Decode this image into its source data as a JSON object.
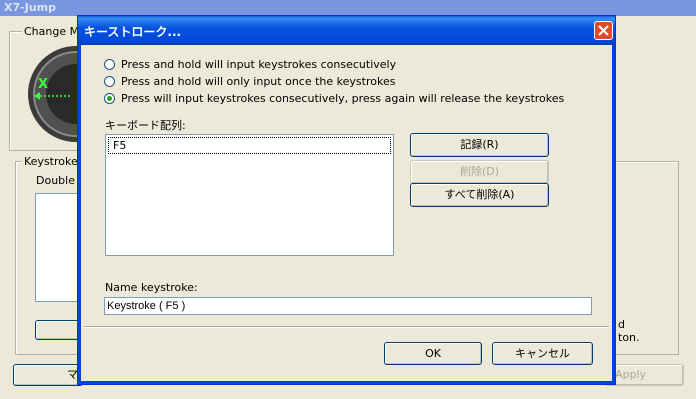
{
  "main_window": {
    "title": "X7-Jump",
    "change_group_label": "Change Mo",
    "keystroke_group_label": "Keystrokes",
    "double_label": "Double c",
    "side_text_line1": "d",
    "side_text_line2": "ton.",
    "apply_label": "Apply",
    "bottom_left_label": "マ"
  },
  "dialog": {
    "title": "キーストローク...",
    "radio_options": [
      {
        "label": "Press and hold will input keystrokes consecutively",
        "selected": false
      },
      {
        "label": "Press and hold will only input once the keystrokes",
        "selected": false
      },
      {
        "label": "Press will input keystrokes consecutively, press again will release the keystrokes",
        "selected": true
      }
    ],
    "keyboard_list_label": "キーボード配列:",
    "keyboard_list_items": [
      "F5"
    ],
    "record_button": "記録(R)",
    "delete_button": "削除(D)",
    "delete_all_button": "すべて削除(A)",
    "name_label": "Name keystroke:",
    "name_value": "Keystroke ( F5 )",
    "ok_button": "OK",
    "cancel_button": "キャンセル"
  },
  "colors": {
    "titlebar_blue": "#0047d4",
    "close_red": "#e04a2a",
    "face": "#ece9d8",
    "selected_dot": "#21a121"
  }
}
